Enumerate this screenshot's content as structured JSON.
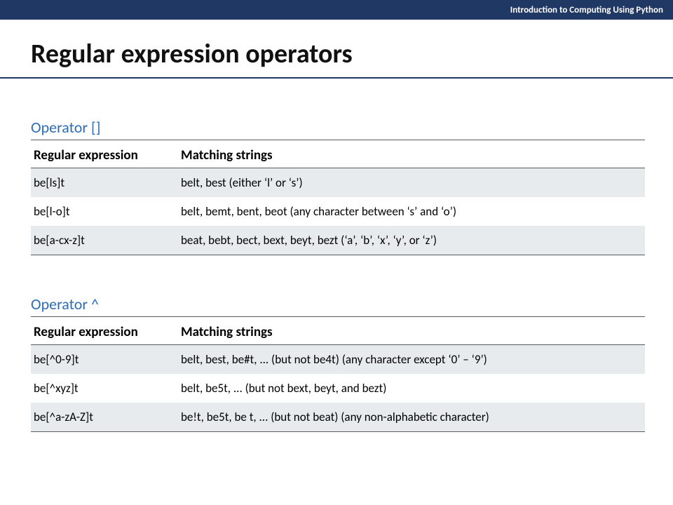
{
  "header": {
    "course": "Introduction to Computing Using Python"
  },
  "title": "Regular expression operators",
  "sections": [
    {
      "label": "Operator []",
      "columns": [
        "Regular expression",
        "Matching strings"
      ],
      "rows": [
        {
          "regex": "be[ls]t",
          "match": "belt, best (either ‘l’ or ‘s’)"
        },
        {
          "regex": "be[l-o]t",
          "match": "belt, bemt, bent, beot (any character between ‘s’ and ‘o’)"
        },
        {
          "regex": "be[a-cx-z]t",
          "match": "beat, bebt, bect, bext, beyt, bezt (‘a’, ‘b’, ‘x’, ‘y’, or ‘z’)"
        }
      ]
    },
    {
      "label": "Operator ^",
      "columns": [
        "Regular expression",
        "Matching strings"
      ],
      "rows": [
        {
          "regex": "be[^0-9]t",
          "match": "belt, best, be#t, ... (but not be4t) (any character except ‘0’ – ‘9’)"
        },
        {
          "regex": "be[^xyz]t",
          "match": "belt, be5t, ... (but not bext, beyt, and bezt)"
        },
        {
          "regex": "be[^a-zA-Z]t",
          "match": "be!t, be5t, be t, ... (but not beat) (any non-alphabetic character)"
        }
      ]
    }
  ]
}
